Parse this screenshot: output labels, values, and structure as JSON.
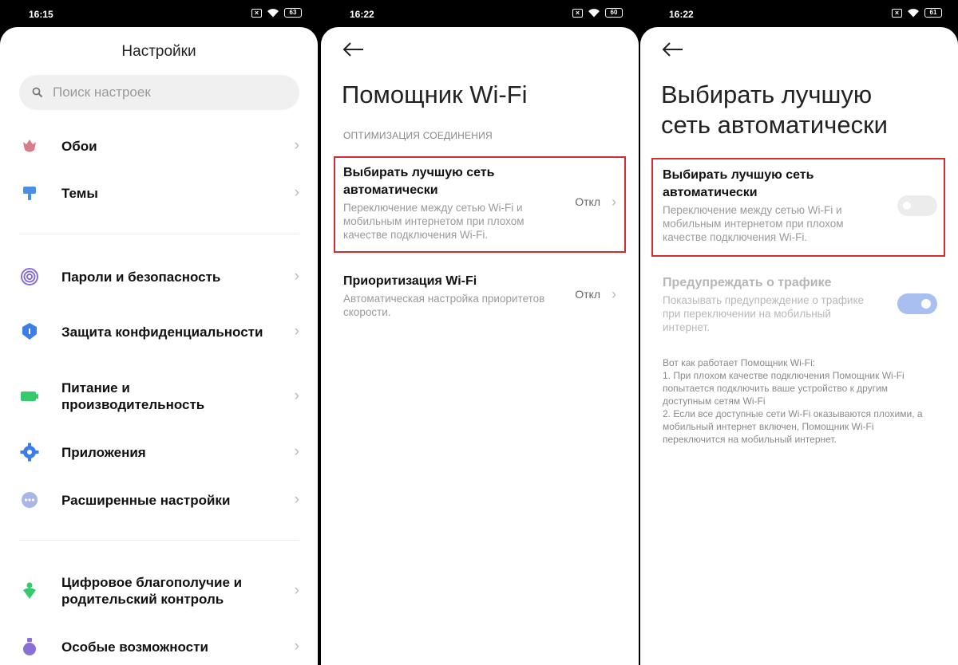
{
  "panel1": {
    "status": {
      "time": "16:15",
      "battery": "63"
    },
    "title": "Настройки",
    "search_placeholder": "Поиск настроек",
    "items": [
      {
        "label": "Обои",
        "icon": "tulip-icon"
      },
      {
        "label": "Темы",
        "icon": "brush-icon"
      },
      {
        "label": "Пароли и безопасность",
        "icon": "fingerprint-icon"
      },
      {
        "label": "Защита конфиденциальности",
        "icon": "shield-icon"
      },
      {
        "label": "Питание и производительность",
        "icon": "battery-icon"
      },
      {
        "label": "Приложения",
        "icon": "gear-icon"
      },
      {
        "label": "Расширенные настройки",
        "icon": "more-dots-icon"
      },
      {
        "label": "Цифровое благополучие и родительский контроль",
        "icon": "wellbeing-icon"
      },
      {
        "label": "Особые возможности",
        "icon": "accessibility-icon"
      }
    ]
  },
  "panel2": {
    "status": {
      "time": "16:22",
      "battery": "60"
    },
    "title": "Помощник Wi-Fi",
    "section": "ОПТИМИЗАЦИЯ СОЕДИНЕНИЯ",
    "options": [
      {
        "title": "Выбирать лучшую сеть автоматически",
        "desc": "Переключение между сетью Wi-Fi и мобильным интернетом при плохом качестве подключения Wi-Fi.",
        "value": "Откл"
      },
      {
        "title": "Приоритизация Wi-Fi",
        "desc": "Автоматическая настройка приоритетов скорости.",
        "value": "Откл"
      }
    ]
  },
  "panel3": {
    "status": {
      "time": "16:22",
      "battery": "61"
    },
    "title_line1": "Выбирать лучшую",
    "title_line2": "сеть автоматически",
    "options": [
      {
        "title": "Выбирать лучшую сеть автоматически",
        "desc": "Переключение между сетью Wi-Fi и мобильным интернетом при плохом качестве подключения Wi-Fi.",
        "toggle": "off"
      },
      {
        "title": "Предупреждать о трафике",
        "desc": "Показывать предупреждение о трафике при переключении на мобильный интернет.",
        "toggle": "on-disabled"
      }
    ],
    "info": [
      "Вот как работает Помощник Wi-Fi:",
      "1. При плохом качестве подключения Помощник Wi-Fi попытается подключить ваше устройство к другим доступным сетям Wi-Fi",
      "2. Если все доступные сети Wi-Fi оказываются плохими, а мобильный интернет включен, Помощник Wi-Fi переключится на мобильный интернет."
    ]
  },
  "colors": {
    "highlight": "#d42c32",
    "toggle_on": "#a9bff0",
    "accent_blue": "#3d7de9"
  }
}
